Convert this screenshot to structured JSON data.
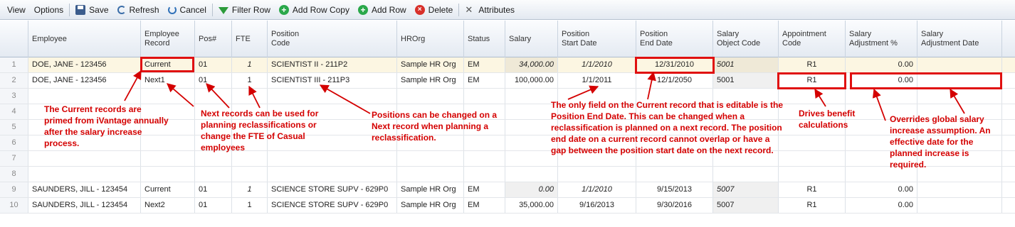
{
  "toolbar": {
    "view": "View",
    "options": "Options",
    "save": "Save",
    "refresh": "Refresh",
    "cancel": "Cancel",
    "filter_row": "Filter Row",
    "add_row_copy": "Add Row Copy",
    "add_row": "Add Row",
    "delete": "Delete",
    "attributes": "Attributes"
  },
  "columns": {
    "employee": "Employee",
    "employee_record": [
      "Employee",
      "Record"
    ],
    "pos": "Pos#",
    "fte": "FTE",
    "position_code": [
      "Position",
      "Code"
    ],
    "hrorg": "HROrg",
    "status": "Status",
    "salary": "Salary",
    "pos_start": [
      "Position",
      "Start Date"
    ],
    "pos_end": [
      "Position",
      "End Date"
    ],
    "salary_obj": [
      "Salary",
      "Object Code"
    ],
    "appt_code": [
      "Appointment",
      "Code"
    ],
    "sal_adj": [
      "Salary",
      "Adjustment %"
    ],
    "sal_adj_date": [
      "Salary",
      "Adjustment Date"
    ]
  },
  "rows": [
    {
      "num": "1",
      "employee": "DOE, JANE - 123456",
      "record": "Current",
      "pos": "01",
      "fte": "1",
      "code": "SCIENTIST II - 211P2",
      "hrorg": "Sample HR Org",
      "status": "EM",
      "salary": "34,000.00",
      "start": "1/1/2010",
      "end": "12/31/2010",
      "obj": "5001",
      "appt": "R1",
      "adj": "0.00",
      "adjdate": ""
    },
    {
      "num": "2",
      "employee": "DOE, JANE - 123456",
      "record": "Next1",
      "pos": "01",
      "fte": "1",
      "code": "SCIENTIST III - 211P3",
      "hrorg": "Sample HR Org",
      "status": "EM",
      "salary": "100,000.00",
      "start": "1/1/2011",
      "end": "12/1/2050",
      "obj": "5001",
      "appt": "R1",
      "adj": "0.00",
      "adjdate": ""
    },
    {
      "num": "3"
    },
    {
      "num": "4"
    },
    {
      "num": "5"
    },
    {
      "num": "6"
    },
    {
      "num": "7"
    },
    {
      "num": "8"
    },
    {
      "num": "9",
      "employee": "SAUNDERS, JILL - 123454",
      "record": "Current",
      "pos": "01",
      "fte": "1",
      "code": "SCIENCE STORE SUPV - 629P0",
      "hrorg": "Sample HR Org",
      "status": "EM",
      "salary": "0.00",
      "start": "1/1/2010",
      "end": "9/15/2013",
      "obj": "5007",
      "appt": "R1",
      "adj": "0.00",
      "adjdate": ""
    },
    {
      "num": "10",
      "employee": "SAUNDERS, JILL - 123454",
      "record": "Next2",
      "pos": "01",
      "fte": "1",
      "code": "SCIENCE STORE SUPV - 629P0",
      "hrorg": "Sample HR Org",
      "status": "EM",
      "salary": "35,000.00",
      "start": "9/16/2013",
      "end": "9/30/2016",
      "obj": "5007",
      "appt": "R1",
      "adj": "0.00",
      "adjdate": ""
    }
  ],
  "annotations": {
    "current": "The Current records are primed from iVantage annually after the salary increase process.",
    "next": "Next records can be used for planning reclassifications or change the FTE of Casual employees",
    "positions": "Positions can be changed on a Next record when planning a reclassification.",
    "end_date": "The only field on the Current record that is editable is the Position End Date.  This can be changed when a reclassification is planned on a next record.  The position end date on a current record cannot overlap or have a gap between the position start date on the next record.",
    "benefit": "Drives benefit calculations",
    "overrides": "Overrides global salary increase assumption. An effective date for the planned increase is required."
  },
  "colors": {
    "annotation": "#d40000",
    "selected_row": "#fcf6e2"
  }
}
